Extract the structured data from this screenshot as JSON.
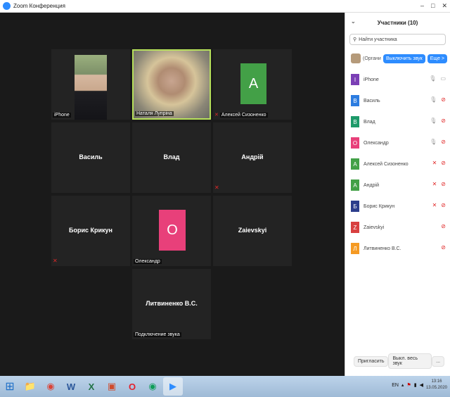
{
  "window": {
    "title": "Zoom Конференция",
    "controls": [
      "–",
      "□",
      "✕"
    ]
  },
  "tiles": [
    {
      "name": "iPhone",
      "type": "video",
      "caption": "iPhone"
    },
    {
      "name": "Наталя Лупріна",
      "type": "video",
      "caption": "Наталя Лупріна",
      "active": true
    },
    {
      "name": "Алексей Сизоненко",
      "type": "avatar",
      "letter": "А",
      "color": "#43a047",
      "caption": "Алексей Сизоненко",
      "muted": true
    },
    {
      "name": "Василь",
      "type": "name"
    },
    {
      "name": "Влад",
      "type": "name"
    },
    {
      "name": "Андрій",
      "type": "name",
      "muted": true
    },
    {
      "name": "Борис Крикун",
      "type": "name",
      "muted": true
    },
    {
      "name": "Олександр",
      "type": "avatar",
      "letter": "О",
      "color": "#e8407a",
      "caption": "Олександр"
    },
    {
      "name": "Zaievskyi",
      "type": "name"
    },
    {
      "name": "Литвиненко В.С.",
      "type": "name",
      "caption": "Подключение звука"
    }
  ],
  "panel": {
    "title": "Участники (10)",
    "collapse_icon": "chevron-down-icon",
    "search_placeholder": "Найти участника",
    "host": {
      "name": "(Органи",
      "mute_button": "Выключить звук",
      "more_button": "Еще >"
    },
    "participants": [
      {
        "letter": "I",
        "name": "iPhone",
        "color": "#7b3fb5",
        "mic": "on",
        "cam": "on"
      },
      {
        "letter": "В",
        "name": "Василь",
        "color": "#2d7de0",
        "mic": "on",
        "cam": "off"
      },
      {
        "letter": "В",
        "name": "Влад",
        "color": "#1e9a6a",
        "mic": "on",
        "cam": "off"
      },
      {
        "letter": "О",
        "name": "Олександр",
        "color": "#e8407a",
        "mic": "on",
        "cam": "off"
      },
      {
        "letter": "А",
        "name": "Алексей Сизоненко",
        "color": "#43a047",
        "mic": "off",
        "cam": "off"
      },
      {
        "letter": "А",
        "name": "Андрій",
        "color": "#43a047",
        "mic": "off",
        "cam": "off"
      },
      {
        "letter": "Б",
        "name": "Борис Крикун",
        "color": "#2c3e8c",
        "mic": "off",
        "cam": "off"
      },
      {
        "letter": "Z",
        "name": "Zaievskyi",
        "color": "#d84040",
        "mic": "none",
        "cam": "off"
      },
      {
        "letter": "Л",
        "name": "Литвиненко В.С.",
        "color": "#f59a23",
        "mic": "none",
        "cam": "off"
      }
    ],
    "footer": {
      "invite": "Пригласить",
      "mute_all": "Выкл. весь звук",
      "more": "..."
    }
  },
  "taskbar": {
    "apps": [
      {
        "icon": "folder-icon",
        "glyph": "📁"
      },
      {
        "icon": "chrome-icon",
        "glyph": "◉"
      },
      {
        "icon": "word-icon",
        "glyph": "W"
      },
      {
        "icon": "excel-icon",
        "glyph": "X"
      },
      {
        "icon": "pdf-icon",
        "glyph": "▣"
      },
      {
        "icon": "opera-icon",
        "glyph": "O"
      },
      {
        "icon": "chrome-icon-2",
        "glyph": "◉"
      },
      {
        "icon": "zoom-icon",
        "glyph": "▶",
        "active": true
      }
    ],
    "lang": "EN",
    "time": "13:16",
    "date": "13.05.2020"
  }
}
